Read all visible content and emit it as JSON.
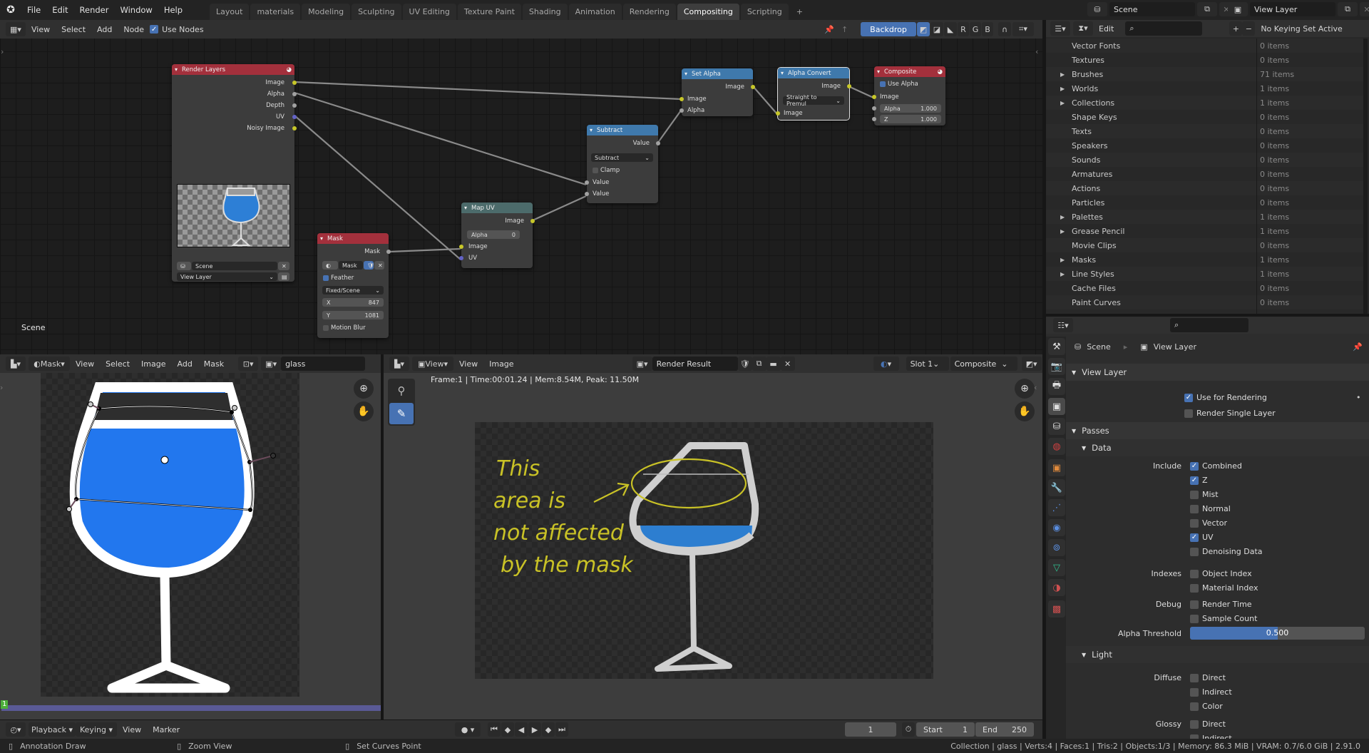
{
  "topbar": {
    "menus": [
      "File",
      "Edit",
      "Render",
      "Window",
      "Help"
    ],
    "workspaces": [
      "Layout",
      "materials",
      "Modeling",
      "Sculpting",
      "UV Editing",
      "Texture Paint",
      "Shading",
      "Animation",
      "Rendering",
      "Compositing",
      "Scripting"
    ],
    "active_workspace": "Compositing",
    "add_tab": "+",
    "scene": "Scene",
    "view_layer": "View Layer"
  },
  "node_editor": {
    "header": {
      "menus": [
        "View",
        "Select",
        "Add",
        "Node"
      ],
      "use_nodes_label": "Use Nodes",
      "use_nodes": true,
      "backdrop_label": "Backdrop",
      "channels": [
        "R",
        "G",
        "B"
      ]
    },
    "scene_label": "Scene",
    "nodes": {
      "render_layers": {
        "title": "Render Layers",
        "outputs": [
          "Image",
          "Alpha",
          "Depth",
          "UV",
          "Noisy Image"
        ],
        "scene": "Scene",
        "view_layer": "View Layer"
      },
      "mask": {
        "title": "Mask",
        "output": "Mask",
        "mask_name": "Mask",
        "feather_label": "Feather",
        "feather": true,
        "size_mode": "Fixed/Scene",
        "x_label": "X",
        "x": "847",
        "y_label": "Y",
        "y": "1081",
        "motion_blur_label": "Motion Blur",
        "motion_blur": false
      },
      "map_uv": {
        "title": "Map UV",
        "output": "Image",
        "alpha_label": "Alpha",
        "alpha": "0",
        "inputs": [
          "Image",
          "UV"
        ]
      },
      "subtract": {
        "title": "Subtract",
        "output": "Value",
        "operation": "Subtract",
        "clamp_label": "Clamp",
        "clamp": false,
        "inputs": [
          "Value",
          "Value"
        ]
      },
      "set_alpha": {
        "title": "Set Alpha",
        "output": "Image",
        "inputs": [
          "Image",
          "Alpha"
        ]
      },
      "alpha_convert": {
        "title": "Alpha Convert",
        "output": "Image",
        "mode": "Straight to Premul",
        "input": "Image"
      },
      "composite": {
        "title": "Composite",
        "use_alpha_label": "Use Alpha",
        "use_alpha": true,
        "input": "Image",
        "alpha_label": "Alpha",
        "alpha": "1.000",
        "z_label": "Z",
        "z": "1.000"
      }
    }
  },
  "outliner": {
    "header": {
      "edit_label": "Edit",
      "keying": "No Keying Set Active"
    },
    "rows": [
      {
        "label": "Vector Fonts",
        "count": "0 items",
        "expandable": false
      },
      {
        "label": "Textures",
        "count": "0 items",
        "expandable": false
      },
      {
        "label": "Brushes",
        "count": "71 items",
        "expandable": true
      },
      {
        "label": "Worlds",
        "count": "1 items",
        "expandable": true
      },
      {
        "label": "Collections",
        "count": "1 items",
        "expandable": true
      },
      {
        "label": "Shape Keys",
        "count": "0 items",
        "expandable": false
      },
      {
        "label": "Texts",
        "count": "0 items",
        "expandable": false
      },
      {
        "label": "Speakers",
        "count": "0 items",
        "expandable": false
      },
      {
        "label": "Sounds",
        "count": "0 items",
        "expandable": false
      },
      {
        "label": "Armatures",
        "count": "0 items",
        "expandable": false
      },
      {
        "label": "Actions",
        "count": "0 items",
        "expandable": false
      },
      {
        "label": "Particles",
        "count": "0 items",
        "expandable": false
      },
      {
        "label": "Palettes",
        "count": "1 items",
        "expandable": true
      },
      {
        "label": "Grease Pencil",
        "count": "1 items",
        "expandable": true
      },
      {
        "label": "Movie Clips",
        "count": "0 items",
        "expandable": false
      },
      {
        "label": "Masks",
        "count": "1 items",
        "expandable": true
      },
      {
        "label": "Line Styles",
        "count": "1 items",
        "expandable": true
      },
      {
        "label": "Cache Files",
        "count": "0 items",
        "expandable": false
      },
      {
        "label": "Paint Curves",
        "count": "0 items",
        "expandable": false
      }
    ]
  },
  "properties": {
    "breadcrumb": [
      "Scene",
      "View Layer"
    ],
    "view_layer_section": "View Layer",
    "use_for_rendering_label": "Use for Rendering",
    "use_for_rendering": true,
    "render_single_layer_label": "Render Single Layer",
    "render_single_layer": false,
    "passes_section": "Passes",
    "data_section": "Data",
    "include_label": "Include",
    "include": [
      {
        "label": "Combined",
        "on": true
      },
      {
        "label": "Z",
        "on": true
      },
      {
        "label": "Mist",
        "on": false
      },
      {
        "label": "Normal",
        "on": false
      },
      {
        "label": "Vector",
        "on": false
      },
      {
        "label": "UV",
        "on": true
      },
      {
        "label": "Denoising Data",
        "on": false
      }
    ],
    "indexes_label": "Indexes",
    "indexes": [
      {
        "label": "Object Index",
        "on": false
      },
      {
        "label": "Material Index",
        "on": false
      }
    ],
    "debug_label": "Debug",
    "debug": [
      {
        "label": "Render Time",
        "on": false
      },
      {
        "label": "Sample Count",
        "on": false
      }
    ],
    "alpha_threshold_label": "Alpha Threshold",
    "alpha_threshold": "0.500",
    "alpha_threshold_fraction": 0.5,
    "light_section": "Light",
    "diffuse_label": "Diffuse",
    "diffuse": [
      {
        "label": "Direct",
        "on": false
      },
      {
        "label": "Indirect",
        "on": false
      },
      {
        "label": "Color",
        "on": false
      }
    ],
    "glossy_label": "Glossy",
    "glossy": [
      {
        "label": "Direct",
        "on": false
      },
      {
        "label": "Indirect",
        "on": false
      }
    ]
  },
  "mask_editor": {
    "mode": "Mask",
    "menus": [
      "View",
      "Select",
      "Image",
      "Add",
      "Mask"
    ],
    "image_name": "glass",
    "frame_indicator": "1"
  },
  "image_editor": {
    "view_mode": "View",
    "menus": [
      "View",
      "Image"
    ],
    "image_name": "Render Result",
    "slot": "Slot 1",
    "layer": "Composite",
    "info": "Frame:1 | Time:00:01.24 | Mem:8.54M, Peak: 11.50M",
    "annotation": [
      "This",
      "area is",
      "not affected",
      "by the mask"
    ],
    "annotation_color": "#c9c226"
  },
  "timeline": {
    "menus": [
      "Playback",
      "Keying",
      "View",
      "Marker"
    ],
    "current_frame": "1",
    "start_label": "Start",
    "start": "1",
    "end_label": "End",
    "end": "250"
  },
  "statusbar": {
    "hints": [
      "Annotation Draw",
      "Zoom View",
      "Set Curves Point"
    ],
    "info": "Collection | glass | Verts:4 | Faces:1 | Tris:2 | Objects:1/3 | Memory: 86.3 MiB | VRAM: 0.7/6.0 GiB | 2.91.0"
  },
  "colors": {
    "accent": "#4772b3",
    "node_input": "#a3303c",
    "node_op": "#3f79ac",
    "node_distort": "#4c6b6b",
    "liquid": "#2277ee"
  }
}
